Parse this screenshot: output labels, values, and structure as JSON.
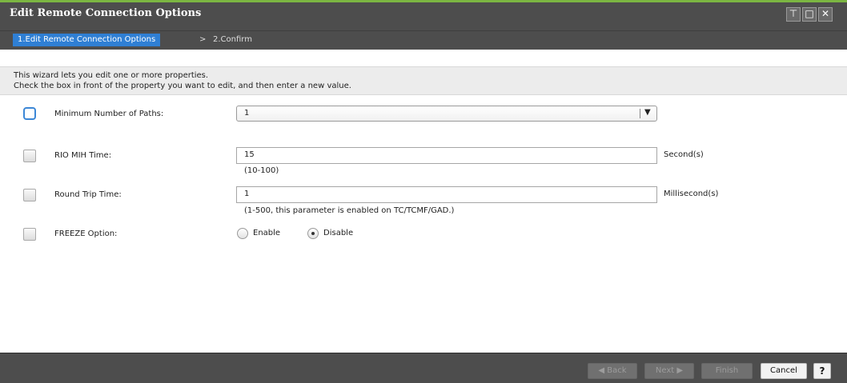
{
  "window": {
    "title": "Edit Remote Connection Options",
    "controls": {
      "pin": "⊤",
      "maximize": "□",
      "close": "✕"
    }
  },
  "wizard": {
    "steps": [
      "1.Edit Remote Connection Options",
      "2.Confirm"
    ],
    "separator": ">",
    "active_step": 0
  },
  "intro": {
    "line1": "This wizard lets you edit one or more properties.",
    "line2": "Check the box in front of the property you want to edit, and then enter a new value."
  },
  "fields": {
    "min_paths": {
      "label": "Minimum Number of Paths:",
      "value": "1",
      "checked": false
    },
    "rio_mih": {
      "label": "RIO MIH Time:",
      "value": "15",
      "unit": "Second(s)",
      "hint": "(10-100)",
      "checked": false
    },
    "round_trip": {
      "label": "Round Trip Time:",
      "value": "1",
      "unit": "Millisecond(s)",
      "hint": "(1-500, this parameter is enabled on TC/TCMF/GAD.)",
      "checked": false
    },
    "freeze": {
      "label": "FREEZE Option:",
      "options": [
        "Enable",
        "Disable"
      ],
      "selected": "Disable",
      "checked": false
    }
  },
  "footer": {
    "back": "◀ Back",
    "next": "Next ▶",
    "finish": "Finish",
    "cancel": "Cancel",
    "help": "?"
  },
  "colors": {
    "accent_green": "#7bb642",
    "active_step_blue": "#2f7fd4",
    "dark_chrome": "#4d4d4d"
  }
}
